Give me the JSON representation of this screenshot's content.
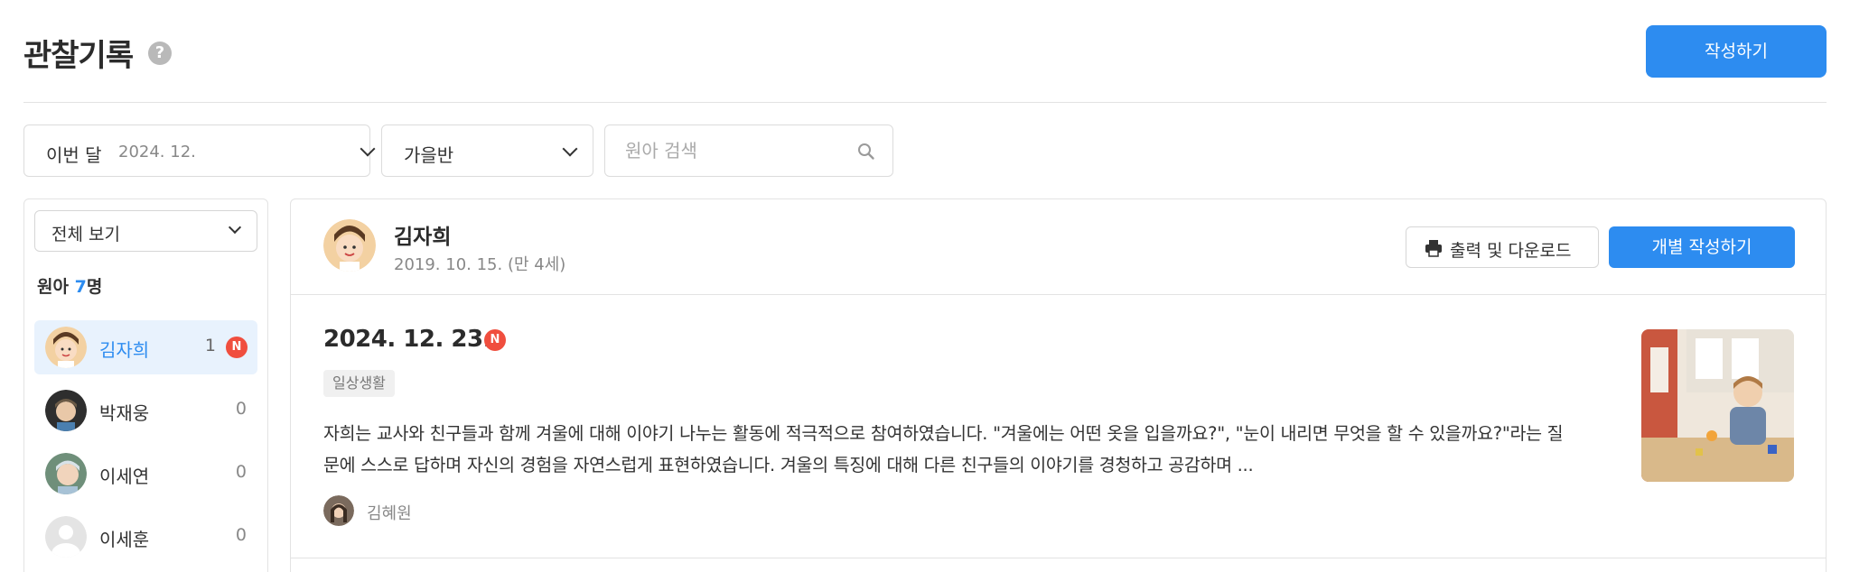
{
  "header": {
    "title": "관찰기록",
    "help_icon": "?",
    "write_button": "작성하기"
  },
  "filters": {
    "month_label": "이번 달",
    "month_value": "2024. 12.",
    "class_value": "가을반",
    "search_placeholder": "원아 검색"
  },
  "sidebar": {
    "view_select": "전체 보기",
    "count_label": "원아",
    "count_num": "7",
    "count_unit": "명",
    "children": [
      {
        "name": "김자희",
        "count": "1",
        "new": "N"
      },
      {
        "name": "박재웅",
        "count": "0"
      },
      {
        "name": "이세연",
        "count": "0"
      },
      {
        "name": "이세훈",
        "count": "0"
      }
    ]
  },
  "profile": {
    "name": "김자희",
    "birth": "2019. 10. 15. (만 4세)",
    "print_button": "출력 및 다운로드",
    "individual_button": "개별 작성하기"
  },
  "record": {
    "date": "2024. 12. 23.",
    "new_badge": "N",
    "tag": "일상생활",
    "text": "자희는 교사와 친구들과 함께 겨울에 대해 이야기 나누는 활동에 적극적으로 참여하였습니다. \"겨울에는 어떤 옷을 입을까요?\", \"눈이 내리면 무엇을 할 수 있을까요?\"라는 질문에 스스로 답하며 자신의 경험을 자연스럽게 표현하였습니다. 겨울의 특징에 대해 다른 친구들의 이야기를 경청하고 공감하며 ...",
    "author": "김혜원"
  },
  "colors": {
    "accent": "#2d8cf0",
    "badge": "#f04e3e",
    "active_bg": "#e8f2fd"
  },
  "icons": [
    "help-icon",
    "chevron-down-icon",
    "search-icon",
    "print-icon",
    "new-badge-icon"
  ]
}
